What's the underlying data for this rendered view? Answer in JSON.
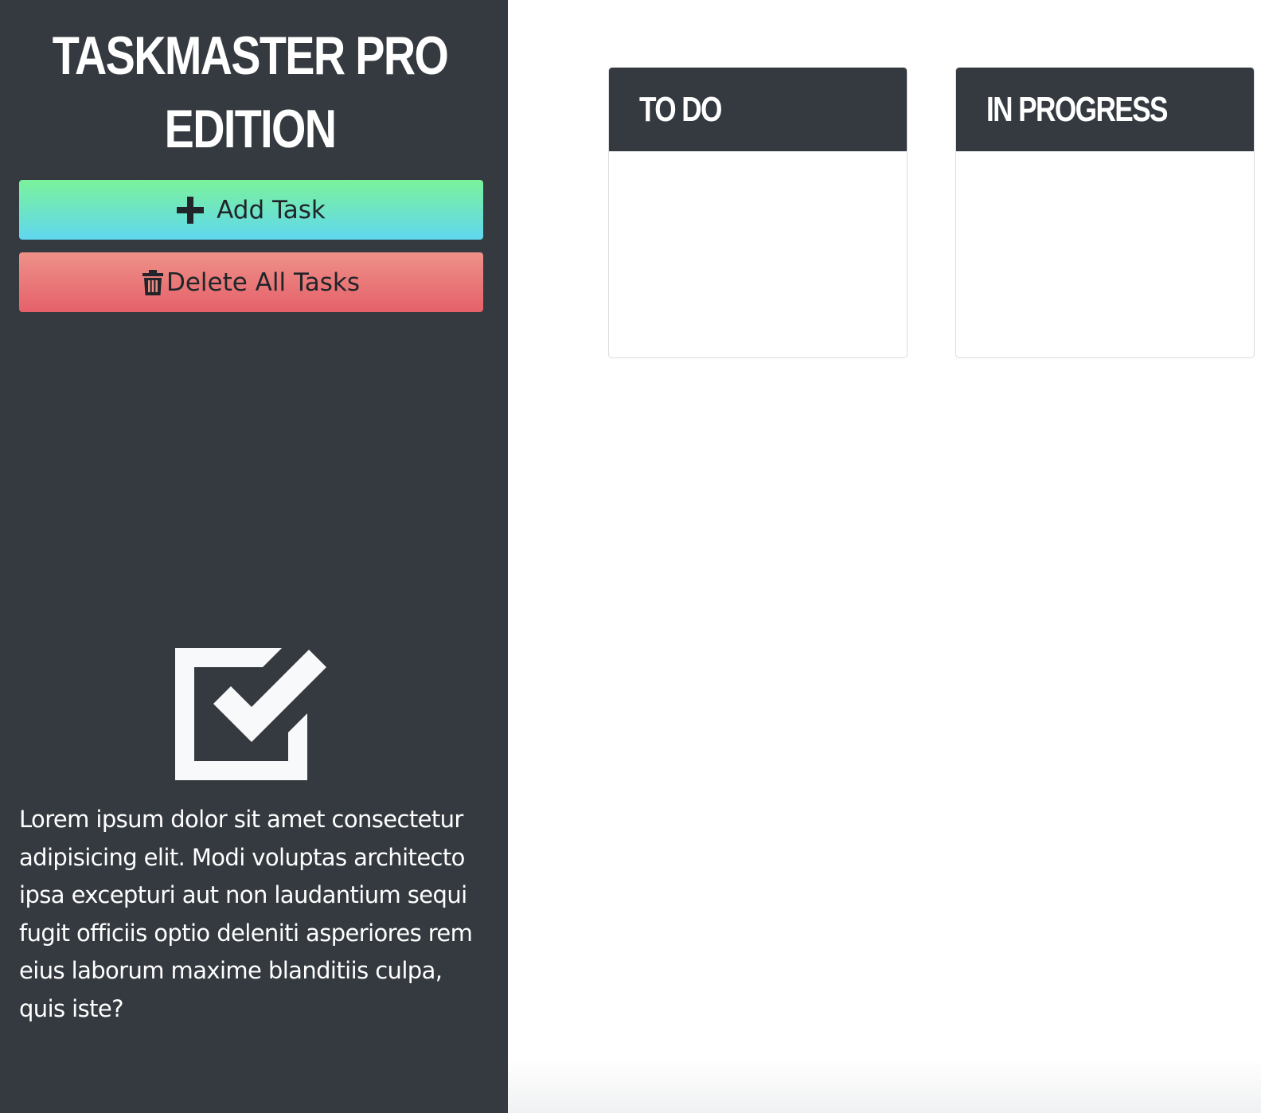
{
  "app": {
    "title": "TASKMASTER PRO EDITION"
  },
  "sidebar": {
    "add_task_label": "Add Task",
    "add_task_icon": "plus-icon",
    "delete_all_label": "Delete All Tasks",
    "delete_all_icon": "trash-icon",
    "hero_icon": "checkbox-checked-icon",
    "description": "Lorem ipsum dolor sit amet consectetur adipisicing elit. Modi voluptas architecto ipsa excepturi aut non laudantium sequi fugit officiis optio deleniti asperiores rem eius laborum maxime blanditiis culpa, quis iste?"
  },
  "board": {
    "columns": [
      {
        "title": "TO DO",
        "tasks": []
      },
      {
        "title": "IN PROGRESS",
        "tasks": []
      }
    ]
  },
  "colors": {
    "sidebar_bg": "#343a40",
    "add_button_top": "#7bf29b",
    "add_button_bottom": "#60d7ef",
    "delete_button_top": "#ee9189",
    "delete_button_bottom": "#e5616a",
    "column_header_bg": "#343a40"
  }
}
